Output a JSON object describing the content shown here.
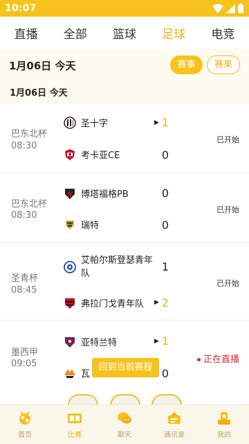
{
  "status_bar": {
    "time": "10:07"
  },
  "tabs": [
    {
      "label": "直播",
      "active": false
    },
    {
      "label": "全部",
      "active": false
    },
    {
      "label": "篮球",
      "active": false
    },
    {
      "label": "足球",
      "active": true
    },
    {
      "label": "电竞",
      "active": false
    }
  ],
  "date_header": {
    "main": "1月06日  今天",
    "sub": "1月06日  今天"
  },
  "filters": {
    "event_label": "赛事",
    "result_label": "赛果"
  },
  "matches": [
    {
      "league": "巴东北杯",
      "time": "08:30",
      "home": {
        "name": "圣十字",
        "score": "1",
        "highlight": true,
        "arrow": true
      },
      "away": {
        "name": "考卡亚CE",
        "score": "0",
        "highlight": false,
        "arrow": false
      },
      "status": "已开始"
    },
    {
      "league": "巴东北杯",
      "time": "08:30",
      "home": {
        "name": "博塔福格PB",
        "score": "0",
        "highlight": false,
        "arrow": false
      },
      "away": {
        "name": "瑞特",
        "score": "0",
        "highlight": false,
        "arrow": false
      },
      "status": "已开始"
    },
    {
      "league": "圣青杯",
      "time": "08:45",
      "home": {
        "name": "艾帕尔斯登瑟青年队",
        "score": "1",
        "highlight": false,
        "arrow": false
      },
      "away": {
        "name": "弗拉门戈青年队",
        "score": "2",
        "highlight": true,
        "arrow": true
      },
      "status": "已开始"
    },
    {
      "league": "墨西甲",
      "time": "09:05",
      "home": {
        "name": "亚特兰特",
        "score": "1",
        "highlight": true,
        "arrow": true
      },
      "away": {
        "name": "瓦",
        "score": "0",
        "highlight": false,
        "arrow": false
      },
      "status": "正在直播"
    }
  ],
  "back_to_current": "回到当前赛程",
  "bottom_nav": [
    {
      "label": "首页",
      "icon": "home-icon",
      "active": false
    },
    {
      "label": "比赛",
      "icon": "match-icon",
      "active": true
    },
    {
      "label": "聊天",
      "icon": "chat-icon",
      "active": false
    },
    {
      "label": "通讯录",
      "icon": "contacts-icon",
      "active": false
    },
    {
      "label": "我的",
      "icon": "profile-icon",
      "active": false
    }
  ],
  "colors": {
    "accent": "#f7c21c",
    "accent_text": "#f2b317",
    "live": "#e0283a",
    "header_bg": "#fffbf0",
    "nav_bg": "#fbf6ea"
  }
}
